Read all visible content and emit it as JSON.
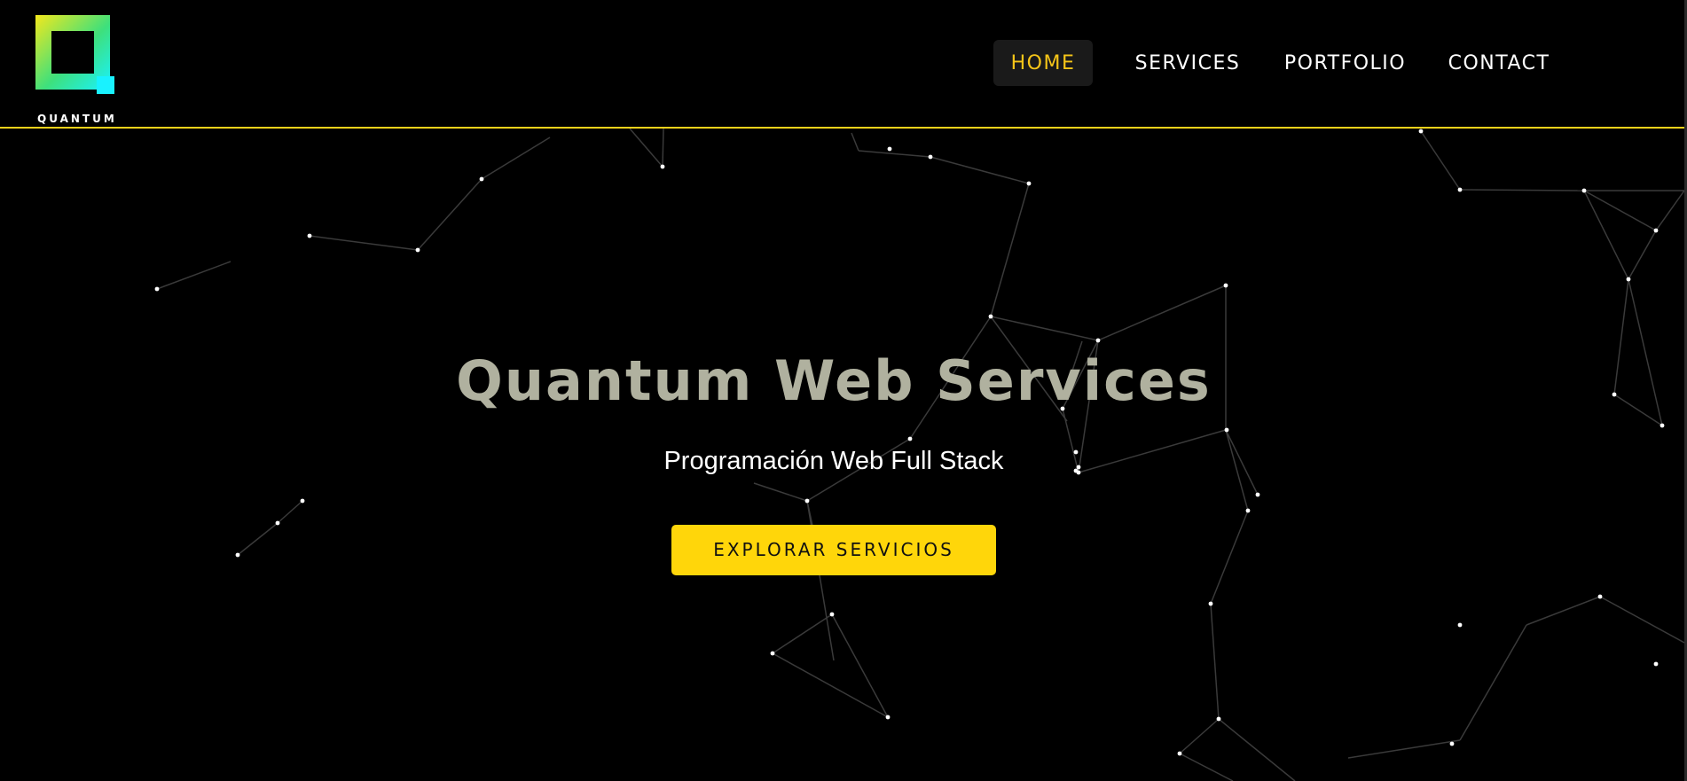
{
  "brand": {
    "name": "QUANTUM",
    "logo_icon": "quantum-square-logo",
    "accent_color": "#ffd60a",
    "logo_gradient": [
      "#f4e81c",
      "#3ee07c",
      "#19f2ff"
    ]
  },
  "nav": {
    "items": [
      {
        "label": "HOME",
        "active": true
      },
      {
        "label": "SERVICES",
        "active": false
      },
      {
        "label": "PORTFOLIO",
        "active": false
      },
      {
        "label": "CONTACT",
        "active": false
      }
    ]
  },
  "hero": {
    "title": "Quantum Web Services",
    "subtitle": "Programación Web Full Stack",
    "cta_label": "EXPLORAR SERVICIOS"
  },
  "background": {
    "type": "particle-network",
    "color": "#000000",
    "line_color": "#3a3a3a",
    "dot_color": "#ffffff"
  }
}
